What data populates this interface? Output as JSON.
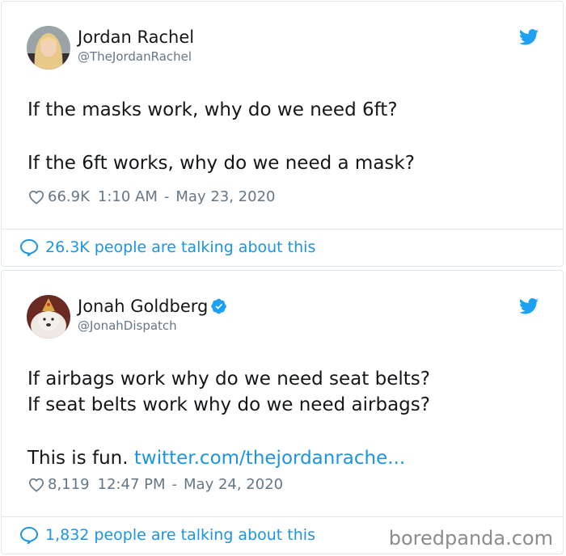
{
  "tweets": [
    {
      "name": "Jordan Rachel",
      "handle": "@TheJordanRachel",
      "verified": false,
      "lines": [
        "If the masks work, why do we need 6ft?",
        "If the 6ft works, why do we need a mask?"
      ],
      "likes": "66.9K",
      "time": "1:10 AM",
      "date": "May 23, 2020",
      "talking": "26.3K people are talking about this"
    },
    {
      "name": "Jonah Goldberg",
      "handle": "@JonahDispatch",
      "verified": true,
      "lines": [
        "If airbags work why do we need seat belts?",
        "If seat belts work why do we need airbags?",
        "This is fun."
      ],
      "link": "twitter.com/thejordanrache...",
      "likes": "8,119",
      "time": "12:47 PM",
      "date": "May 24, 2020",
      "talking": "1,832 people are talking about this"
    }
  ],
  "watermark": "boredpanda.com",
  "icons": {
    "bird": "twitter-bird-icon",
    "heart": "heart-icon",
    "bubble": "reply-bubble-icon",
    "verified": "verified-badge-icon"
  },
  "colors": {
    "accent": "#1b95e0",
    "muted": "#657786",
    "text": "#14171a",
    "border": "#e1e8ed"
  }
}
